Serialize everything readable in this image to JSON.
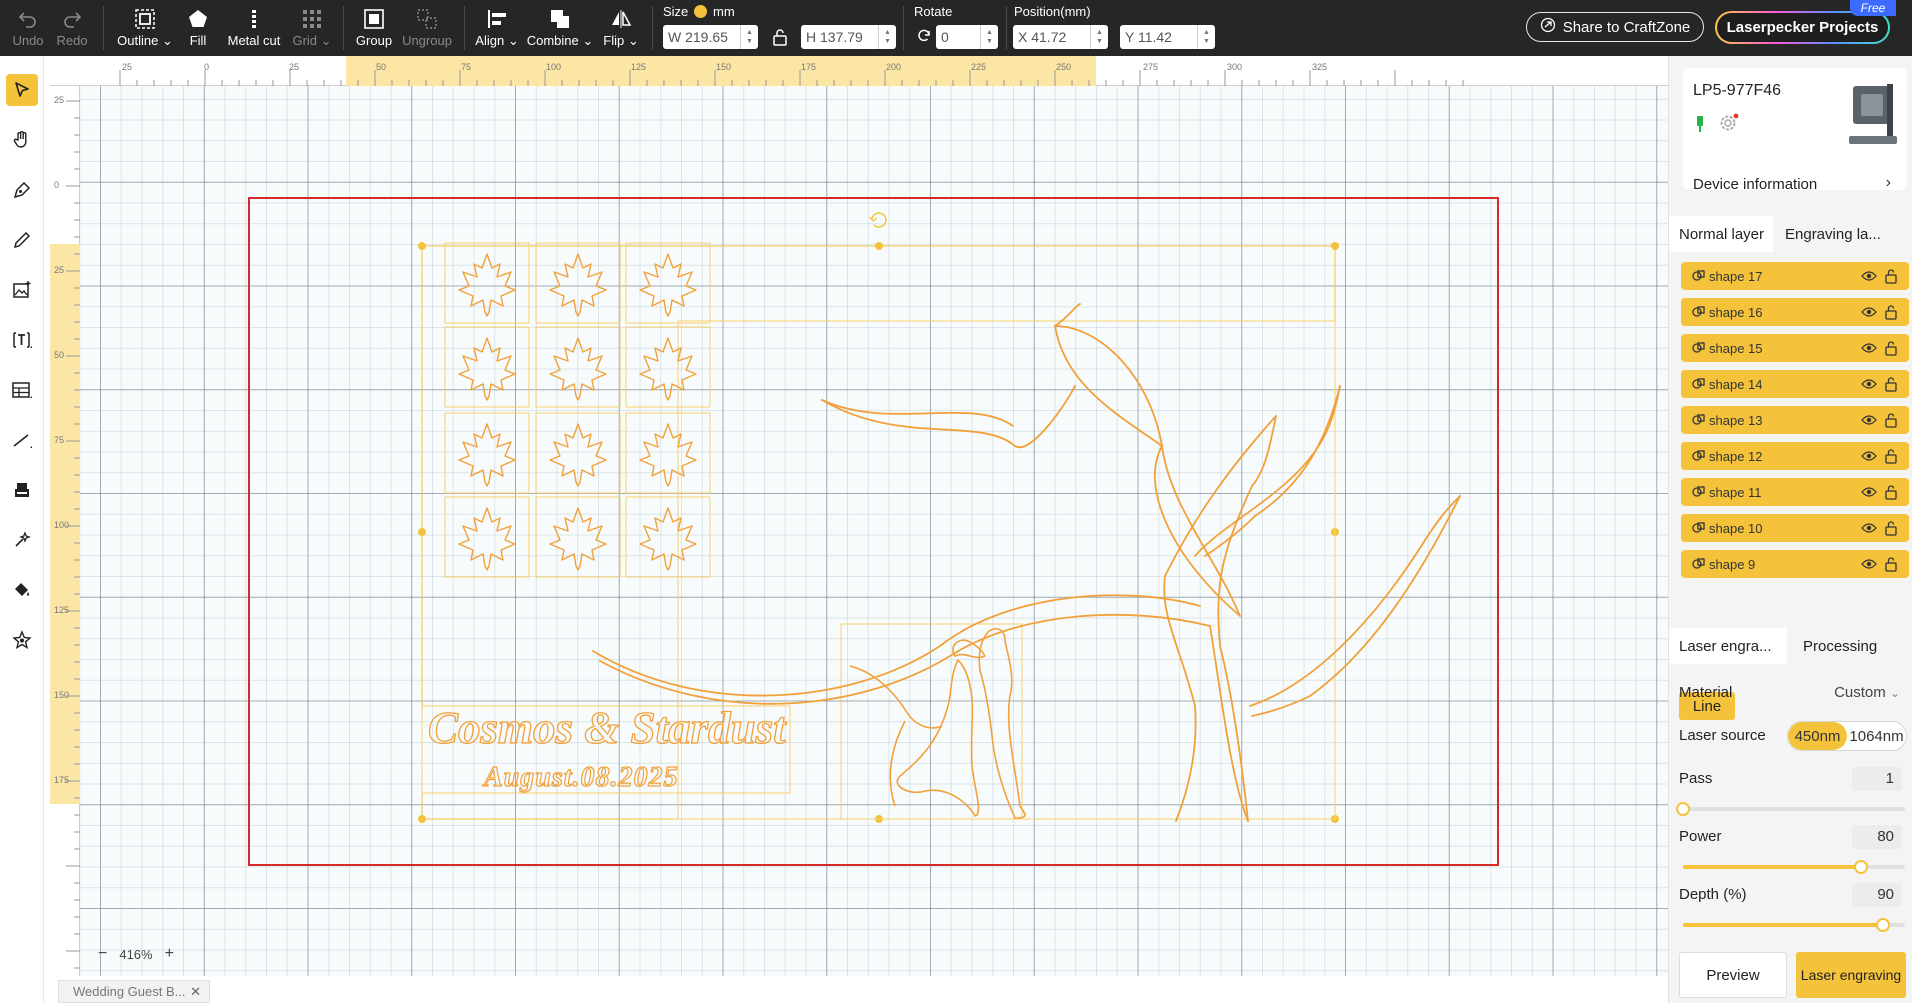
{
  "toolbar": {
    "undo": "Undo",
    "redo": "Redo",
    "outline": "Outline",
    "fill": "Fill",
    "metal_cut": "Metal cut",
    "grid": "Grid",
    "group": "Group",
    "ungroup": "Ungroup",
    "align": "Align",
    "combine": "Combine",
    "flip": "Flip",
    "size_label": "Size",
    "unit": "mm",
    "width": "W 219.65",
    "height": "H 137.79",
    "rotate_label": "Rotate",
    "rotate": "0",
    "position_label": "Position(mm)",
    "pos_x": "X 41.72",
    "pos_y": "Y 11.42",
    "share": "Share to CraftZone",
    "projects": "Laserpecker Projects",
    "free_badge": "Free"
  },
  "left_tools": [
    "select-tool",
    "hand-tool",
    "pen-tool",
    "pencil-tool",
    "image-tool",
    "text-tool",
    "table-tool",
    "line-tool",
    "stamp-tool",
    "magic-tool",
    "fill-tool",
    "shape-library-tool"
  ],
  "ruler_top": [
    "25",
    "0",
    "25",
    "50",
    "75",
    "100",
    "125",
    "150",
    "175",
    "200",
    "225",
    "250",
    "275",
    "300",
    "325"
  ],
  "ruler_left": [
    "25",
    "0",
    "25",
    "50",
    "75",
    "100",
    "125",
    "150",
    "175"
  ],
  "canvas": {
    "title_text": "Cosmos & Stardust",
    "date_text": "August.08.2025",
    "zoom": "416%"
  },
  "file_tab": "Wedding Guest B...",
  "right_panel": {
    "device_name": "LP5-977F46",
    "device_info": "Device information",
    "tab_normal": "Normal layer",
    "tab_engraving": "Engraving la...",
    "layers": [
      {
        "name": "shape 17"
      },
      {
        "name": "shape 16"
      },
      {
        "name": "shape 15"
      },
      {
        "name": "shape 14"
      },
      {
        "name": "shape 13"
      },
      {
        "name": "shape 12"
      },
      {
        "name": "shape 11"
      },
      {
        "name": "shape 10"
      },
      {
        "name": "shape 9"
      }
    ],
    "tab_laser": "Laser engra...",
    "tab_processing": "Processing",
    "line_chip": "Line",
    "material_label": "Material",
    "material_value": "Custom",
    "laser_source_label": "Laser source",
    "source_450": "450nm",
    "source_1064": "1064nm",
    "pass_label": "Pass",
    "pass_value": "1",
    "pass_level": 0.0,
    "power_label": "Power",
    "power_value": "80",
    "power_level": 0.8,
    "depth_label": "Depth (%)",
    "depth_value": "90",
    "depth_level": 0.9,
    "preview": "Preview",
    "laser_engraving": "Laser engraving"
  },
  "colors": {
    "accent": "#f5c33b",
    "toolbar_bg": "#262626",
    "work_area_border": "#d42a2a",
    "design_stroke": "#f2a13a"
  }
}
